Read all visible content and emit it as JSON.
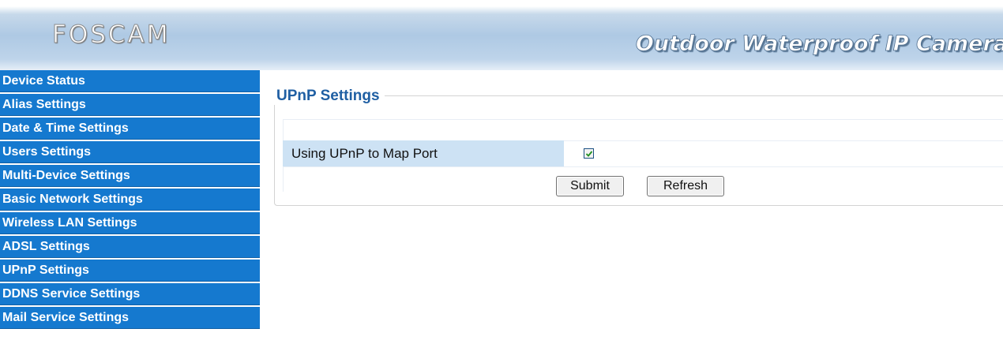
{
  "header": {
    "logo": "FOSCAM",
    "product_title": "Outdoor Waterproof IP Camera"
  },
  "sidebar": {
    "items": [
      {
        "label": "Device Status"
      },
      {
        "label": "Alias Settings"
      },
      {
        "label": "Date & Time Settings"
      },
      {
        "label": "Users Settings"
      },
      {
        "label": "Multi-Device Settings"
      },
      {
        "label": "Basic Network Settings"
      },
      {
        "label": "Wireless LAN Settings"
      },
      {
        "label": "ADSL Settings"
      },
      {
        "label": "UPnP Settings"
      },
      {
        "label": "DDNS Service Settings"
      },
      {
        "label": "Mail Service Settings"
      }
    ]
  },
  "main": {
    "section_title": "UPnP Settings",
    "upnp_label": "Using UPnP to Map Port",
    "upnp_checked": true,
    "submit_label": "Submit",
    "refresh_label": "Refresh"
  },
  "colors": {
    "sidebar_bg": "#1579cf",
    "title_color": "#1f5fa3",
    "label_bg": "#cde2f4"
  }
}
